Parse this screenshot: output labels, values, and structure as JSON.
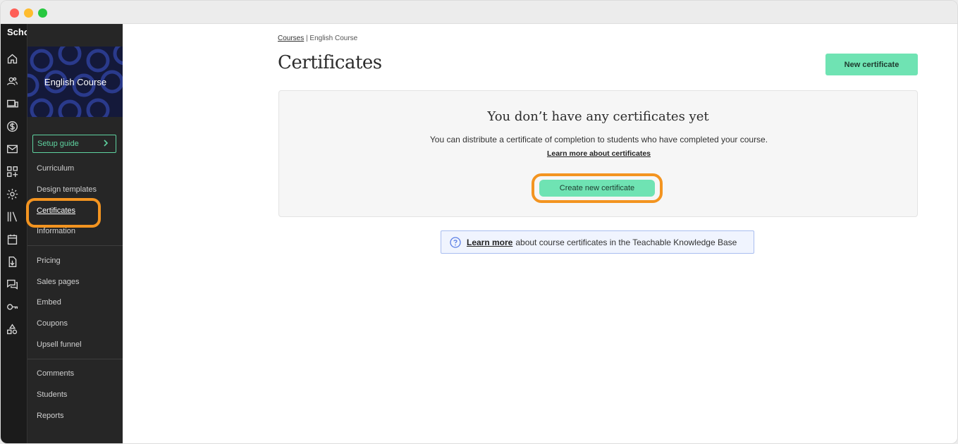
{
  "sidebar": {
    "brand": "School",
    "rail_icons": [
      "home-icon",
      "users-icon",
      "devices-icon",
      "dollar-icon",
      "mail-icon",
      "apps-icon",
      "gear-icon",
      "library-icon",
      "calendar-icon",
      "download-icon",
      "comments-icon",
      "key-icon",
      "shapes-icon"
    ]
  },
  "course_nav": {
    "course_title": "English Course",
    "setup_guide": "Setup guide",
    "items_group1": [
      "Curriculum",
      "Design templates",
      "Certificates",
      "Information"
    ],
    "items_group2": [
      "Pricing",
      "Sales pages",
      "Embed",
      "Coupons",
      "Upsell funnel"
    ],
    "items_group3": [
      "Comments",
      "Students",
      "Reports"
    ],
    "active_item": "Certificates"
  },
  "main": {
    "breadcrumb": {
      "link": "Courses",
      "separator": "|",
      "current": "English Course"
    },
    "title": "Certificates",
    "new_certificate_button": "New certificate",
    "empty_state": {
      "title": "You don’t have any certificates yet",
      "description": "You can distribute a certificate of completion to students who have completed your course.",
      "learn_link": "Learn more about certificates",
      "create_button": "Create new certificate"
    },
    "knowledge_base": {
      "icon": "question-circle-icon",
      "link": "Learn more",
      "text": "about course certificates in the Teachable Knowledge Base"
    }
  },
  "colors": {
    "accent_green": "#6fe3b3",
    "highlight_orange": "#f39420",
    "sidebar_dark": "#262626"
  }
}
